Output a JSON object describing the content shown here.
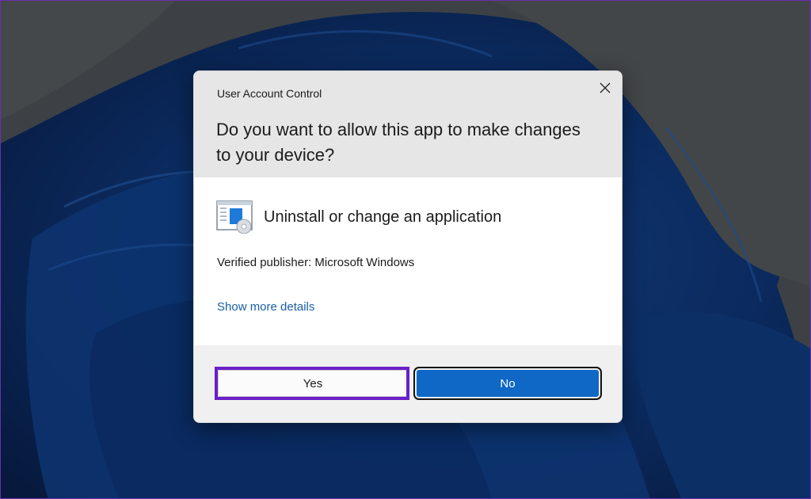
{
  "dialog": {
    "title": "User Account Control",
    "question": "Do you want to allow this app to make changes to your device?",
    "app_name": "Uninstall or change an application",
    "publisher": "Verified publisher: Microsoft Windows",
    "details_link": "Show more details",
    "close_icon": "close-icon",
    "app_icon": "programs-and-features-icon"
  },
  "buttons": {
    "yes_label": "Yes",
    "no_label": "No"
  },
  "colors": {
    "accent": "#0f67c6",
    "link": "#1a5fa6",
    "highlight": "#6a1fc8",
    "header_bg": "#e6e6e6"
  }
}
